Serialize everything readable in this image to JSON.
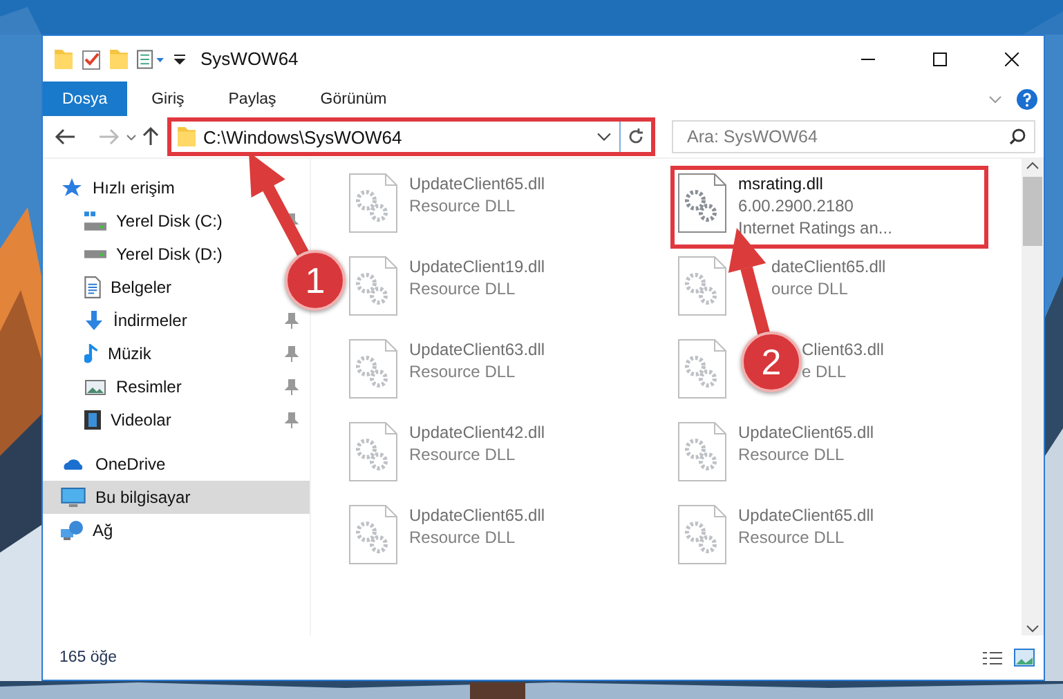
{
  "window": {
    "title": "SysWOW64"
  },
  "ribbon_tabs": [
    {
      "label": "Dosya",
      "selected": true
    },
    {
      "label": "Giriş",
      "selected": false
    },
    {
      "label": "Paylaş",
      "selected": false
    },
    {
      "label": "Görünüm",
      "selected": false
    }
  ],
  "address": {
    "path": "C:\\Windows\\SysWOW64",
    "highlighted": true
  },
  "search": {
    "placeholder": "Ara: SysWOW64"
  },
  "sidebar": {
    "items": [
      {
        "label": "Hızlı erişim",
        "selected": false,
        "children": [
          {
            "label": "Yerel Disk (C:)",
            "pinned": true,
            "selected": false
          },
          {
            "label": "Yerel Disk (D:)",
            "pinned": false,
            "selected": false
          },
          {
            "label": "Belgeler",
            "pinned": false,
            "selected": false
          },
          {
            "label": "İndirmeler",
            "pinned": true,
            "selected": false
          },
          {
            "label": "Müzik",
            "pinned": true,
            "selected": false
          },
          {
            "label": "Resimler",
            "pinned": true,
            "selected": false
          },
          {
            "label": "Videolar",
            "pinned": true,
            "selected": false
          }
        ]
      },
      {
        "label": "OneDrive",
        "selected": false
      },
      {
        "label": "Bu bilgisayar",
        "selected": true
      },
      {
        "label": "Ağ",
        "selected": false
      }
    ]
  },
  "files": [
    {
      "kind": "whole",
      "name": "UpdateClient65.dll",
      "details": [
        "Resource DLL"
      ],
      "blurred": true,
      "highlighted": false
    },
    {
      "kind": "whole",
      "name": "msrating.dll",
      "details": [
        "6.00.2900.2180",
        "Internet Ratings an..."
      ],
      "blurred": false,
      "highlighted": true
    },
    {
      "kind": "whole",
      "name": "UpdateClient19.dll",
      "details": [
        "Resource DLL"
      ],
      "blurred": true,
      "highlighted": false
    },
    {
      "kind": "arrowed",
      "name": "dateClient65.dll",
      "details": [
        "ource DLL"
      ],
      "blurred": true,
      "highlighted": false
    },
    {
      "kind": "whole",
      "name": "UpdateClient63.dll",
      "details": [
        "Resource DLL"
      ],
      "blurred": true,
      "highlighted": false
    },
    {
      "kind": "badged",
      "name": "Client63.dll",
      "details": [
        "e DLL"
      ],
      "blurred": true,
      "highlighted": false
    },
    {
      "kind": "whole",
      "name": "UpdateClient42.dll",
      "details": [
        "Resource DLL"
      ],
      "blurred": true,
      "highlighted": false
    },
    {
      "kind": "whole",
      "name": "UpdateClient65.dll",
      "details": [
        "Resource DLL"
      ],
      "blurred": true,
      "highlighted": false
    },
    {
      "kind": "whole",
      "name": "UpdateClient65.dll",
      "details": [
        "Resource DLL"
      ],
      "blurred": true,
      "highlighted": false
    },
    {
      "kind": "whole",
      "name": "UpdateClient65.dll",
      "details": [
        "Resource DLL"
      ],
      "blurred": true,
      "highlighted": false
    }
  ],
  "status_bar": {
    "item_count": "165 öğe"
  },
  "annotations": [
    {
      "label": "1"
    },
    {
      "label": "2"
    }
  ]
}
